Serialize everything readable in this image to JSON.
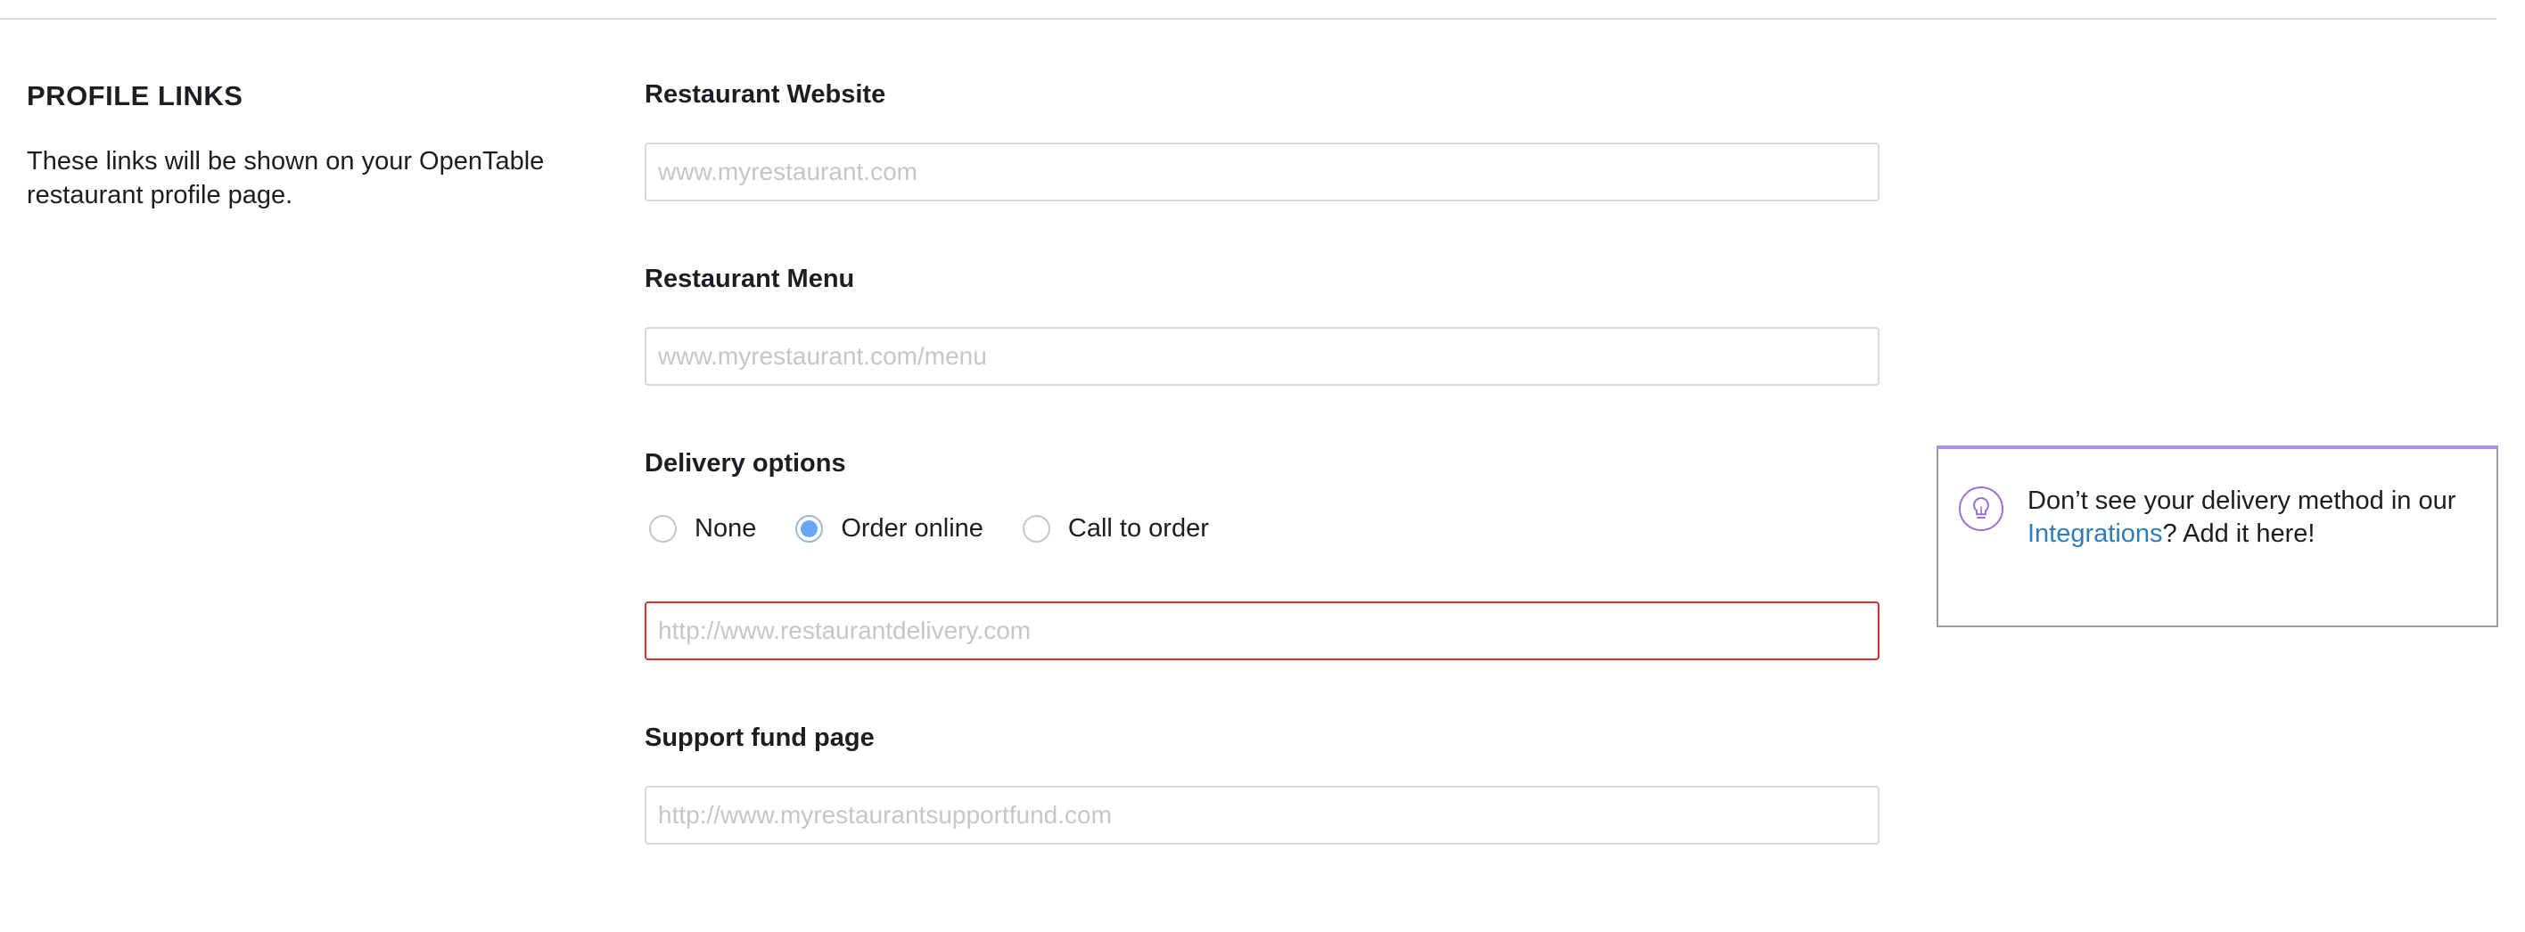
{
  "profile_links": {
    "title": "PROFILE LINKS",
    "description": "These links will be shown on your OpenTable restaurant profile page."
  },
  "fields": {
    "website": {
      "label": "Restaurant Website",
      "value": "",
      "placeholder": "www.myrestaurant.com"
    },
    "menu": {
      "label": "Restaurant Menu",
      "value": "",
      "placeholder": "www.myrestaurant.com/menu"
    },
    "delivery": {
      "label": "Delivery options",
      "options": [
        {
          "label": "None",
          "selected": false
        },
        {
          "label": "Order online",
          "selected": true
        },
        {
          "label": "Call to order",
          "selected": false
        }
      ],
      "url_value": "",
      "url_placeholder": "http://www.restaurantdelivery.com",
      "url_state": "error"
    },
    "support_fund": {
      "label": "Support fund page",
      "value": "",
      "placeholder": "http://www.myrestaurantsupportfund.com"
    }
  },
  "tip": {
    "icon": "lightbulb-icon",
    "text_before": "Don’t see your delivery method in our ",
    "link_text": "Integrations",
    "text_after": "? Add it here!"
  },
  "colors": {
    "error_border": "#d9302f",
    "link": "#2f7db8",
    "radio_selected": "#6aa6f8",
    "tip_accent": "#b38ee3"
  }
}
